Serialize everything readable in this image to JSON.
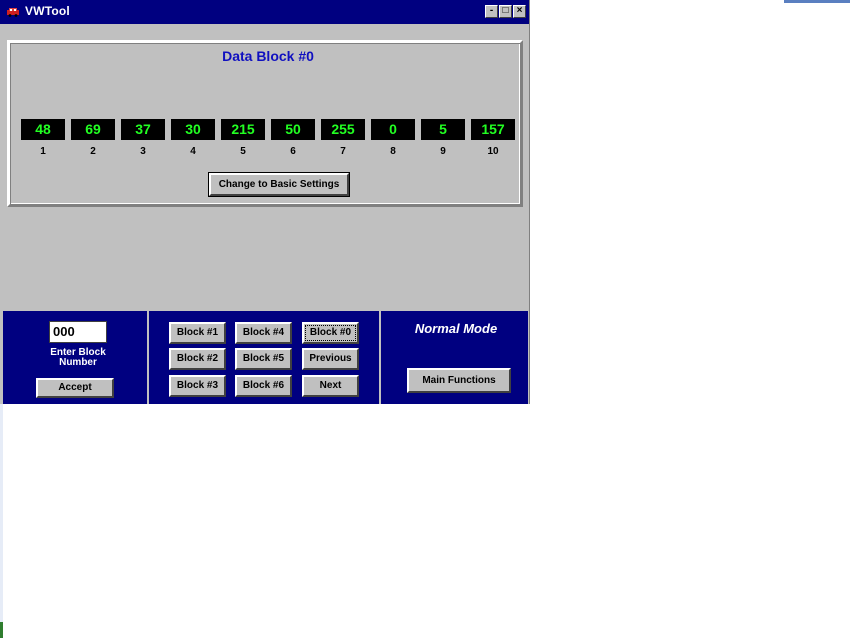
{
  "window": {
    "title": "VWTool",
    "min_glyph": "-",
    "max_glyph": "□",
    "close_glyph": "×"
  },
  "data_block": {
    "title": "Data Block #0",
    "values": [
      "48",
      "69",
      "37",
      "30",
      "215",
      "50",
      "255",
      "0",
      "5",
      "157"
    ],
    "indices": [
      "1",
      "2",
      "3",
      "4",
      "5",
      "6",
      "7",
      "8",
      "9",
      "10"
    ],
    "basic_settings_label": "Change to Basic Settings"
  },
  "bottom": {
    "block_input_value": "000",
    "enter_label_line1": "Enter Block",
    "enter_label_line2": "Number",
    "accept_label": "Accept",
    "blocks": {
      "b1": "Block #1",
      "b2": "Block #2",
      "b3": "Block #3",
      "b4": "Block #4",
      "b5": "Block #5",
      "b6": "Block #6",
      "b0": "Block #0",
      "previous": "Previous",
      "next": "Next"
    },
    "mode_label": "Normal Mode",
    "main_functions_label": "Main Functions"
  },
  "colors": {
    "title_bar": "#000080",
    "value_text": "#22ff22",
    "value_bg": "#000000",
    "block_title": "#1010c0",
    "panel": "#000080"
  }
}
